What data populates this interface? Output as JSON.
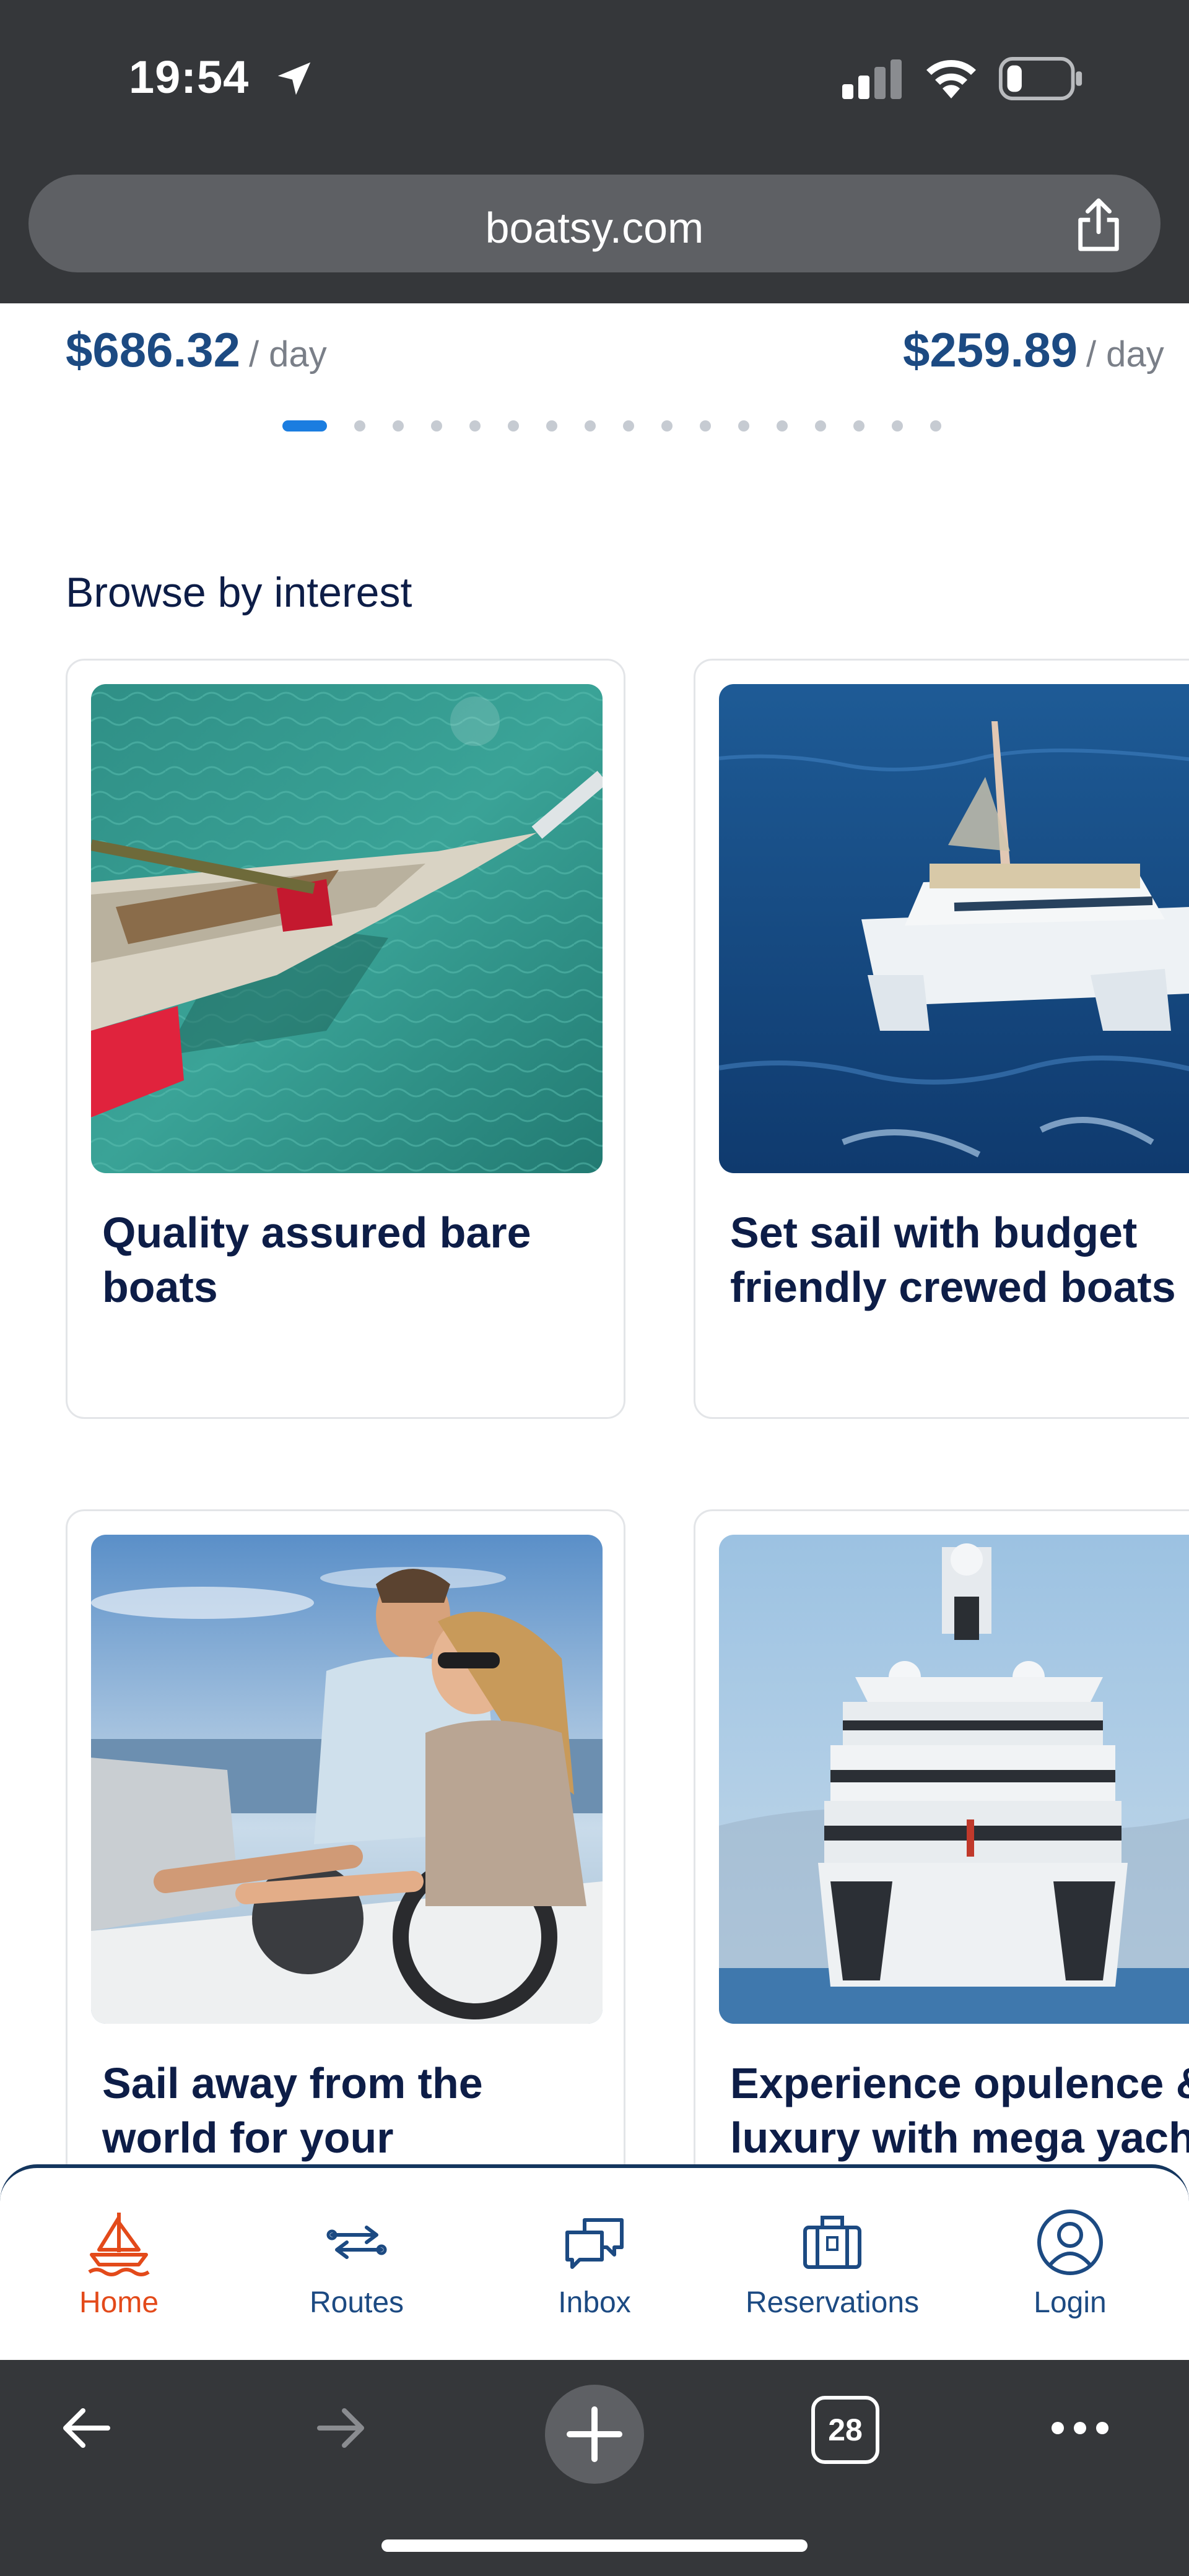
{
  "status_bar": {
    "time": "19:54"
  },
  "browser": {
    "url": "boatsy.com",
    "tab_count": "28"
  },
  "prices": [
    {
      "amount": "$686.32",
      "unit": "/ day"
    },
    {
      "amount": "$259.89",
      "unit": "/ day"
    }
  ],
  "carousel": {
    "total_dots": 17,
    "active_index": 0
  },
  "section_title": "Browse by interest",
  "cards": [
    {
      "title": "Quality assured bare boats",
      "image": "sailboat-aerial"
    },
    {
      "title": "Set sail with budget friendly crewed boats",
      "image": "catamaran"
    },
    {
      "title": "Sail away from the world for your",
      "image": "couple-at-helm"
    },
    {
      "title": "Experience opulence & luxury with mega yacht",
      "image": "mega-yacht"
    }
  ],
  "nav": [
    {
      "label": "Home",
      "icon": "sailboat-icon",
      "active": true
    },
    {
      "label": "Routes",
      "icon": "routes-icon",
      "active": false
    },
    {
      "label": "Inbox",
      "icon": "chat-icon",
      "active": false
    },
    {
      "label": "Reservations",
      "icon": "suitcase-icon",
      "active": false
    },
    {
      "label": "Login",
      "icon": "user-icon",
      "active": false
    }
  ],
  "colors": {
    "brand_blue": "#1c4a82",
    "active_orange": "#e34a1a",
    "dark_navy": "#0d1d47"
  }
}
